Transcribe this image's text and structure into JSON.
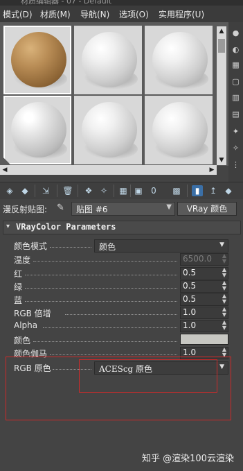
{
  "titlebar": {
    "text": "材质编辑器 - 07 - Default"
  },
  "menu": [
    {
      "label": "模式(D)"
    },
    {
      "label": "材质(M)"
    },
    {
      "label": "导航(N)"
    },
    {
      "label": "选项(O)"
    },
    {
      "label": "实用程序(U)"
    }
  ],
  "slots": [
    {
      "material": "wood"
    },
    {
      "material": "white-matte"
    },
    {
      "material": "white-matte"
    },
    {
      "material": "white-glossy"
    },
    {
      "material": "white-matte"
    },
    {
      "material": "white-matte"
    }
  ],
  "map_row": {
    "label": "漫反射贴图:",
    "map_name": "贴图 #6",
    "map_type": "VRay 颜色"
  },
  "rollout": {
    "title": "VRayColor Parameters",
    "collapse_symbol": "▾",
    "params": {
      "color_mode": {
        "label": "颜色模式",
        "value": "颜色"
      },
      "temperature": {
        "label": "温度",
        "value": "6500.0"
      },
      "red": {
        "label": "红",
        "value": "0.5"
      },
      "green": {
        "label": "绿",
        "value": "0.5"
      },
      "blue": {
        "label": "蓝",
        "value": "0.5"
      },
      "rgb_multiplier": {
        "label": "RGB 倍增",
        "value": "1.0"
      },
      "alpha": {
        "label": "Alpha",
        "value": "1.0"
      },
      "color": {
        "label": "颜色",
        "swatch": "#c7c7c2"
      },
      "color_gamma": {
        "label": "颜色伽马",
        "value": "1.0"
      },
      "rgb_primaries": {
        "label": "RGB 原色",
        "value": "ACEScg 原色"
      }
    }
  },
  "watermark": "知乎 @渲染100云渲染",
  "colors": {
    "highlight_red": "#d02a2a",
    "active_tool": "#3b6fa6"
  }
}
